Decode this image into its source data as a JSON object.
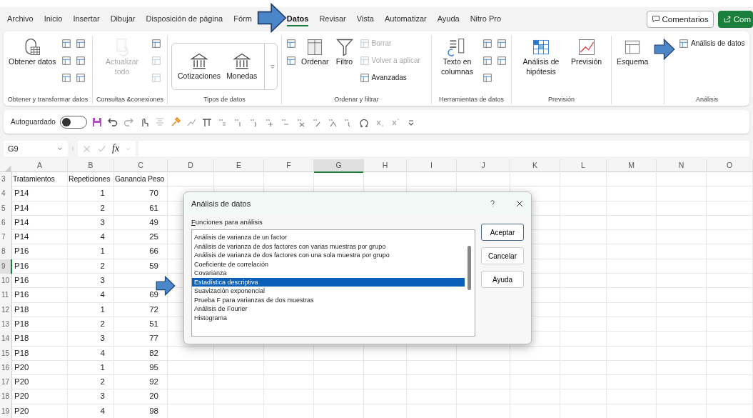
{
  "menu_tabs": [
    {
      "label": "Archivo",
      "selected": false
    },
    {
      "label": "Inicio",
      "selected": false
    },
    {
      "label": "Insertar",
      "selected": false
    },
    {
      "label": "Dibujar",
      "selected": false
    },
    {
      "label": "Disposición de página",
      "selected": false
    },
    {
      "label": "Fórm",
      "selected": false
    },
    {
      "label": "Datos",
      "selected": true
    },
    {
      "label": "Revisar",
      "selected": false
    },
    {
      "label": "Vista",
      "selected": false
    },
    {
      "label": "Automatizar",
      "selected": false
    },
    {
      "label": "Ayuda",
      "selected": false
    },
    {
      "label": "Nitro Pro",
      "selected": false
    }
  ],
  "header_buttons": [
    {
      "label": "Comentarios",
      "kind": "outline"
    },
    {
      "label": "Com",
      "kind": "primary"
    }
  ],
  "ribbon": {
    "groups": [
      {
        "kind": "get",
        "label": "Obtener y transformar datos",
        "commands": [
          {
            "kind": "large",
            "label": "Obtener datos",
            "disabled": false
          },
          {
            "kind": "icon",
            "disabled": false
          },
          {
            "kind": "icon",
            "disabled": false
          },
          {
            "kind": "icon",
            "disabled": false
          },
          {
            "kind": "icon",
            "disabled": false
          },
          {
            "kind": "icon",
            "disabled": false
          },
          {
            "kind": "icon",
            "disabled": false
          }
        ]
      },
      {
        "kind": "queries",
        "label": "Consultas &conexiones",
        "commands": [
          {
            "kind": "large",
            "label": "Actualizar todo",
            "disabled": true
          },
          {
            "kind": "icon",
            "disabled": false
          },
          {
            "kind": "icon",
            "disabled": true
          },
          {
            "kind": "icon",
            "disabled": true
          }
        ]
      },
      {
        "kind": "types",
        "label": "Tipos de datos",
        "commands": [
          {
            "kind": "large",
            "label": "Cotizaciones",
            "disabled": false
          },
          {
            "kind": "large",
            "label": "Monedas",
            "disabled": false
          },
          {
            "kind": "more",
            "disabled": false
          }
        ]
      },
      {
        "kind": "sort",
        "label": "Ordenar y filtrar",
        "commands": [
          {
            "kind": "icon",
            "disabled": false
          },
          {
            "kind": "icon",
            "disabled": false
          },
          {
            "kind": "large",
            "label": "Ordenar",
            "disabled": false
          },
          {
            "kind": "large",
            "label": "Filtro",
            "disabled": false
          },
          {
            "kind": "small",
            "label": "Borrar",
            "disabled": true
          },
          {
            "kind": "small",
            "label": "Volver a aplicar",
            "disabled": true
          },
          {
            "kind": "small",
            "label": "Avanzadas",
            "disabled": false
          }
        ]
      },
      {
        "kind": "tools",
        "label": "Herramientas de datos",
        "commands": [
          {
            "kind": "large",
            "label": "Texto en columnas",
            "disabled": false
          },
          {
            "kind": "icon",
            "disabled": false
          },
          {
            "kind": "icon",
            "disabled": false
          },
          {
            "kind": "icon",
            "disabled": false
          },
          {
            "kind": "icon",
            "disabled": false
          },
          {
            "kind": "icon",
            "disabled": false
          }
        ]
      },
      {
        "kind": "forecast",
        "label": "Previsión",
        "commands": [
          {
            "kind": "large",
            "label": "Análisis de hipótesis",
            "disabled": false
          },
          {
            "kind": "large",
            "label": "Previsión",
            "disabled": false
          }
        ]
      },
      {
        "kind": "outline",
        "commands": [
          {
            "kind": "large",
            "label": "Esquema",
            "disabled": false
          }
        ]
      },
      {
        "kind": "analysis",
        "label": "Análisis",
        "commands": [
          {
            "kind": "small",
            "label": "Análisis de datos",
            "disabled": false
          }
        ]
      }
    ]
  },
  "quick_access": {
    "autosave_label": "Autoguardado",
    "autosave_on": false
  },
  "formula_bar": {
    "name_box": "G9",
    "function_label": "fx"
  },
  "sheet": {
    "columns": [
      {
        "label": "A",
        "selected": false
      },
      {
        "label": "B",
        "selected": false
      },
      {
        "label": "C",
        "selected": false
      },
      {
        "label": "D",
        "selected": false
      },
      {
        "label": "E",
        "selected": false
      },
      {
        "label": "F",
        "selected": false
      },
      {
        "label": "G",
        "selected": true
      },
      {
        "label": "H",
        "selected": false
      },
      {
        "label": "I",
        "selected": false
      },
      {
        "label": "J",
        "selected": false
      },
      {
        "label": "K",
        "selected": false
      },
      {
        "label": "L",
        "selected": false
      },
      {
        "label": "M",
        "selected": false
      },
      {
        "label": "N",
        "selected": false
      },
      {
        "label": "O",
        "selected": false
      }
    ],
    "rows": [
      {
        "header": "3",
        "selected": false,
        "kind": "header",
        "cells": [
          "Tratamientos",
          "Repeticiones",
          "Ganancia Peso"
        ]
      },
      {
        "header": "4",
        "selected": false,
        "kind": "data",
        "cells": [
          "P14",
          "1",
          "70"
        ]
      },
      {
        "header": "5",
        "selected": false,
        "kind": "data",
        "cells": [
          "P14",
          "2",
          "61"
        ]
      },
      {
        "header": "6",
        "selected": false,
        "kind": "data",
        "cells": [
          "P14",
          "3",
          "49"
        ]
      },
      {
        "header": "7",
        "selected": false,
        "kind": "data",
        "cells": [
          "P14",
          "4",
          "25"
        ]
      },
      {
        "header": "8",
        "selected": false,
        "kind": "data",
        "cells": [
          "P16",
          "1",
          "66"
        ]
      },
      {
        "header": "9",
        "selected": true,
        "kind": "data",
        "cells": [
          "P16",
          "2",
          "59"
        ]
      },
      {
        "header": "10",
        "selected": false,
        "kind": "data",
        "cells": [
          "P16",
          "3",
          null
        ]
      },
      {
        "header": "11",
        "selected": false,
        "kind": "data",
        "cells": [
          "P16",
          "4",
          "69"
        ]
      },
      {
        "header": "12",
        "selected": false,
        "kind": "data",
        "cells": [
          "P18",
          "1",
          "72"
        ]
      },
      {
        "header": "13",
        "selected": false,
        "kind": "data",
        "cells": [
          "P18",
          "2",
          "51"
        ]
      },
      {
        "header": "14",
        "selected": false,
        "kind": "data",
        "cells": [
          "P18",
          "3",
          "77"
        ]
      },
      {
        "header": "15",
        "selected": false,
        "kind": "data",
        "cells": [
          "P18",
          "4",
          "82"
        ]
      },
      {
        "header": "16",
        "selected": false,
        "kind": "data",
        "cells": [
          "P20",
          "1",
          "95"
        ]
      },
      {
        "header": "17",
        "selected": false,
        "kind": "data",
        "cells": [
          "P20",
          "2",
          "92"
        ]
      },
      {
        "header": "18",
        "selected": false,
        "kind": "data",
        "cells": [
          "P20",
          "3",
          "20"
        ]
      },
      {
        "header": "19",
        "selected": false,
        "kind": "data",
        "cells": [
          "P20",
          "4",
          "98"
        ]
      }
    ]
  },
  "dialog": {
    "title": "Análisis de datos",
    "list_label": "Funciones para análisis",
    "items": [
      {
        "label": "Análisis de varianza de un factor",
        "selected": false
      },
      {
        "label": "Análisis de varianza de dos factores con varias muestras por grupo",
        "selected": false
      },
      {
        "label": "Análisis de varianza de dos factores con una sola muestra por grupo",
        "selected": false
      },
      {
        "label": "Coeficiente de correlación",
        "selected": false
      },
      {
        "label": "Covarianza",
        "selected": false
      },
      {
        "label": "Estadística descriptiva",
        "selected": true
      },
      {
        "label": "Suavización exponencial",
        "selected": false
      },
      {
        "label": "Prueba F para varianzas de dos muestras",
        "selected": false
      },
      {
        "label": "Análisis de Fourier",
        "selected": false
      },
      {
        "label": "Histograma",
        "selected": false
      }
    ],
    "buttons": [
      {
        "label": "Aceptar",
        "default": true
      },
      {
        "label": "Cancelar",
        "default": false
      },
      {
        "label": "Ayuda",
        "default": false
      }
    ]
  }
}
